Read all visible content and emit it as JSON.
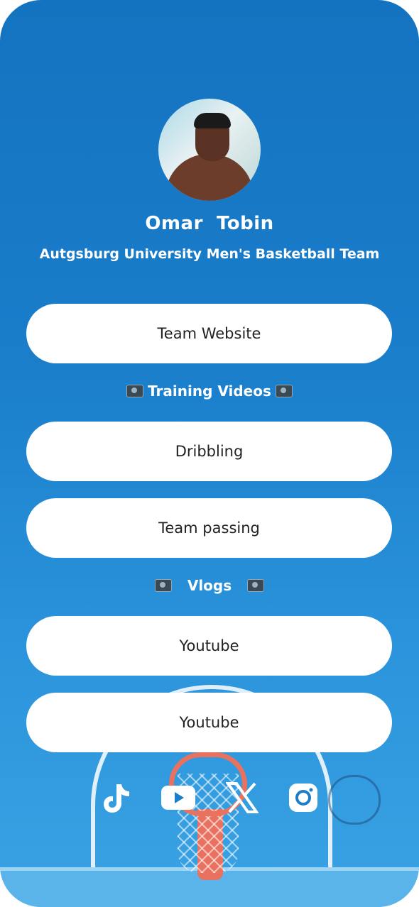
{
  "profile": {
    "name": "Omar  Tobin",
    "subtitle": "Autgsburg University Men's Basketball Team"
  },
  "links": [
    {
      "label": "Team Website"
    },
    {
      "label": "Dribbling"
    },
    {
      "label": "Team passing"
    },
    {
      "label": "Youtube"
    },
    {
      "label": "Youtube"
    }
  ],
  "sections": {
    "training": "Training Videos",
    "vlogs": "Vlogs"
  },
  "socials": [
    {
      "icon": "tiktok-icon"
    },
    {
      "icon": "youtube-icon"
    },
    {
      "icon": "x-icon"
    },
    {
      "icon": "instagram-icon"
    }
  ],
  "colors": {
    "background": "#1a7ecb",
    "button": "#ffffff",
    "button_text": "#222222",
    "accent_rim": "#e9715f"
  }
}
